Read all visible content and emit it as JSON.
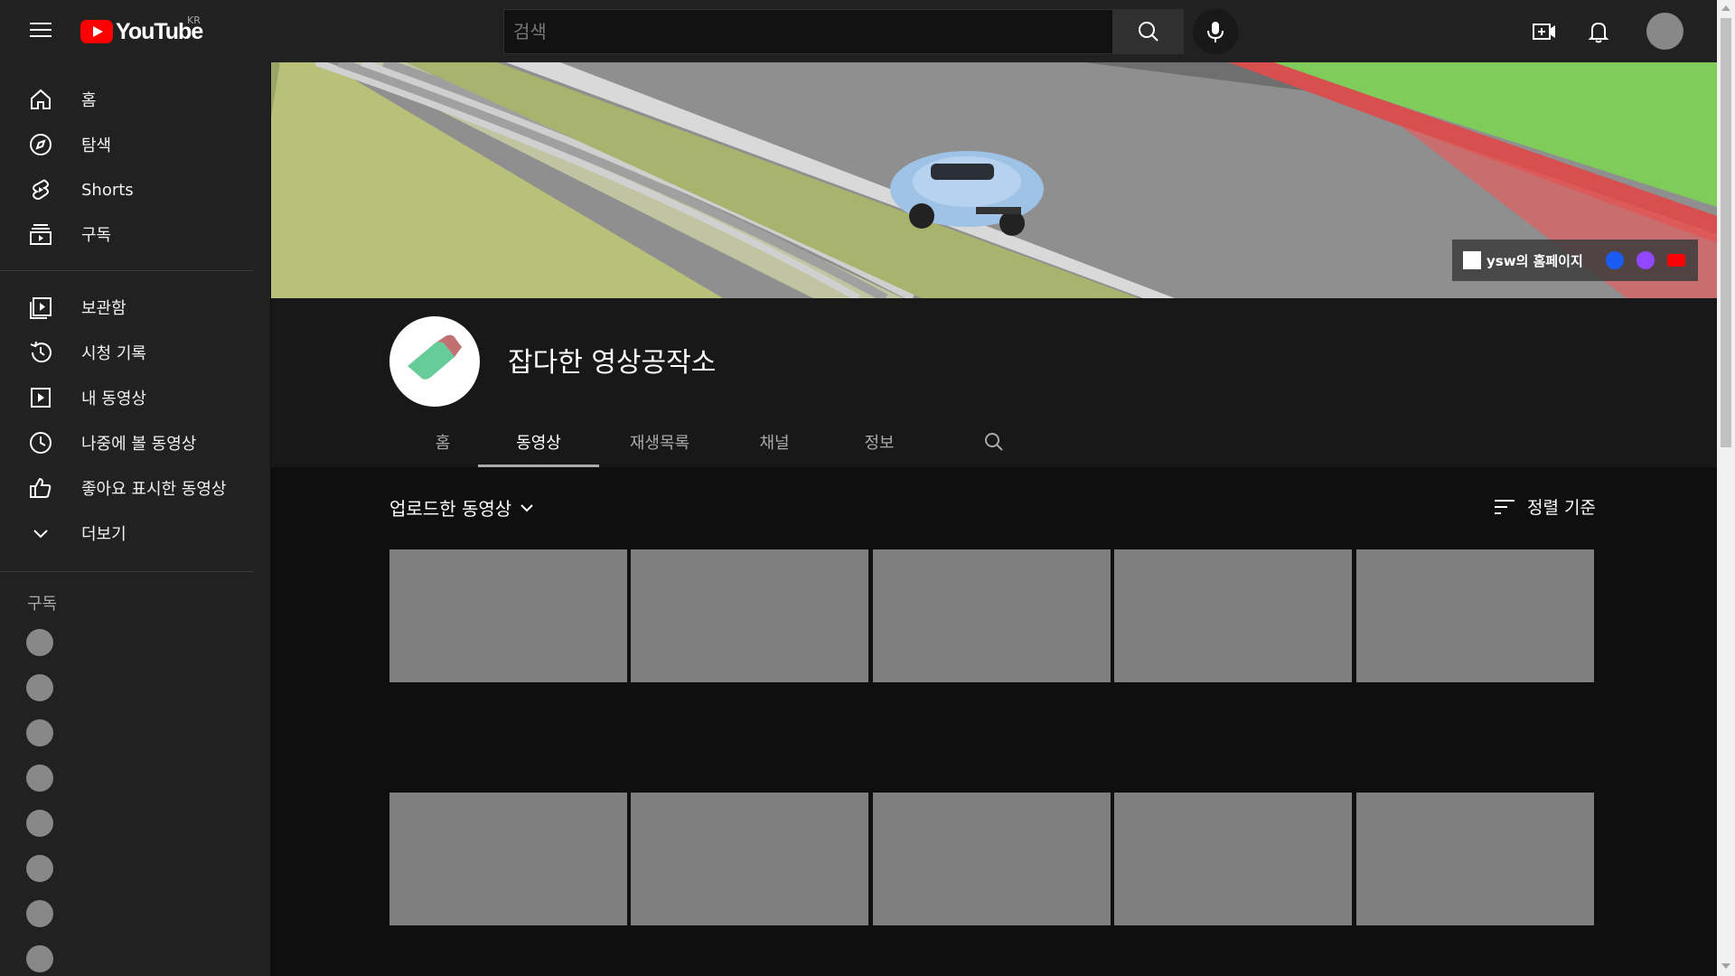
{
  "app": {
    "logo_text": "YouTube",
    "region": "KR"
  },
  "search": {
    "placeholder": "검색"
  },
  "sidebar": {
    "items": [
      {
        "label": "홈",
        "icon": "home-icon"
      },
      {
        "label": "탐색",
        "icon": "compass-icon"
      },
      {
        "label": "Shorts",
        "icon": "shorts-icon"
      },
      {
        "label": "구독",
        "icon": "subscriptions-icon"
      },
      {
        "label": "보관함",
        "icon": "library-icon"
      },
      {
        "label": "시청 기록",
        "icon": "history-icon"
      },
      {
        "label": "내 동영상",
        "icon": "play-icon"
      },
      {
        "label": "나중에 볼 동영상",
        "icon": "clock-icon"
      },
      {
        "label": "좋아요 표시한 동영상",
        "icon": "thumbs-up-icon"
      },
      {
        "label": "더보기",
        "icon": "chevron-down-icon"
      }
    ],
    "subscriptions_title": "구독",
    "subscription_count": 8
  },
  "banner": {
    "link_label": "ysw의 홈페이지"
  },
  "channel": {
    "name": "잡다한 영상공작소"
  },
  "tabs": [
    {
      "label": "홈",
      "active": false
    },
    {
      "label": "동영상",
      "active": true
    },
    {
      "label": "재생목록",
      "active": false
    },
    {
      "label": "채널",
      "active": false
    },
    {
      "label": "정보",
      "active": false
    }
  ],
  "videos": {
    "filter_label": "업로드한 동영상",
    "sort_label": "정렬 기준"
  },
  "colors": {
    "brand_red": "#ff0000",
    "placeholder_thumb": "#7f7f7f"
  }
}
